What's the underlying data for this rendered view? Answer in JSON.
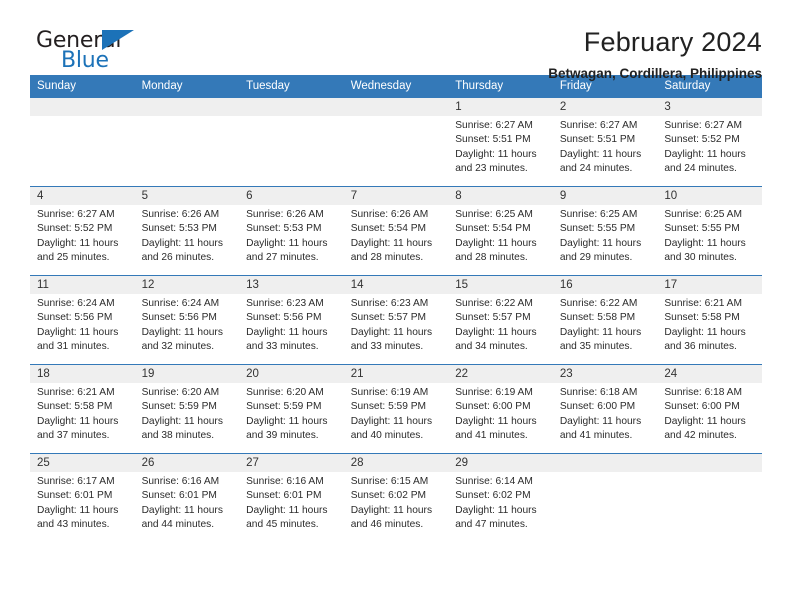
{
  "brand": {
    "name_top": "General",
    "name_bottom": "Blue"
  },
  "header": {
    "title": "February 2024",
    "subtitle": "Betwagan, Cordillera, Philippines"
  },
  "weekday_headers": [
    "Sunday",
    "Monday",
    "Tuesday",
    "Wednesday",
    "Thursday",
    "Friday",
    "Saturday"
  ],
  "labels": {
    "sunrise_prefix": "Sunrise:",
    "sunset_prefix": "Sunset:",
    "daylight_prefix": "Daylight:"
  },
  "colors": {
    "header_blue": "#3479b8",
    "brand_blue": "#1c72b8",
    "daynum_bg": "#efefef"
  },
  "weeks": [
    [
      {
        "empty": true
      },
      {
        "empty": true
      },
      {
        "empty": true
      },
      {
        "empty": true
      },
      {
        "day": "1",
        "sunrise": "Sunrise: 6:27 AM",
        "sunset": "Sunset: 5:51 PM",
        "daylight": "Daylight: 11 hours and 23 minutes."
      },
      {
        "day": "2",
        "sunrise": "Sunrise: 6:27 AM",
        "sunset": "Sunset: 5:51 PM",
        "daylight": "Daylight: 11 hours and 24 minutes."
      },
      {
        "day": "3",
        "sunrise": "Sunrise: 6:27 AM",
        "sunset": "Sunset: 5:52 PM",
        "daylight": "Daylight: 11 hours and 24 minutes."
      }
    ],
    [
      {
        "day": "4",
        "sunrise": "Sunrise: 6:27 AM",
        "sunset": "Sunset: 5:52 PM",
        "daylight": "Daylight: 11 hours and 25 minutes."
      },
      {
        "day": "5",
        "sunrise": "Sunrise: 6:26 AM",
        "sunset": "Sunset: 5:53 PM",
        "daylight": "Daylight: 11 hours and 26 minutes."
      },
      {
        "day": "6",
        "sunrise": "Sunrise: 6:26 AM",
        "sunset": "Sunset: 5:53 PM",
        "daylight": "Daylight: 11 hours and 27 minutes."
      },
      {
        "day": "7",
        "sunrise": "Sunrise: 6:26 AM",
        "sunset": "Sunset: 5:54 PM",
        "daylight": "Daylight: 11 hours and 28 minutes."
      },
      {
        "day": "8",
        "sunrise": "Sunrise: 6:25 AM",
        "sunset": "Sunset: 5:54 PM",
        "daylight": "Daylight: 11 hours and 28 minutes."
      },
      {
        "day": "9",
        "sunrise": "Sunrise: 6:25 AM",
        "sunset": "Sunset: 5:55 PM",
        "daylight": "Daylight: 11 hours and 29 minutes."
      },
      {
        "day": "10",
        "sunrise": "Sunrise: 6:25 AM",
        "sunset": "Sunset: 5:55 PM",
        "daylight": "Daylight: 11 hours and 30 minutes."
      }
    ],
    [
      {
        "day": "11",
        "sunrise": "Sunrise: 6:24 AM",
        "sunset": "Sunset: 5:56 PM",
        "daylight": "Daylight: 11 hours and 31 minutes."
      },
      {
        "day": "12",
        "sunrise": "Sunrise: 6:24 AM",
        "sunset": "Sunset: 5:56 PM",
        "daylight": "Daylight: 11 hours and 32 minutes."
      },
      {
        "day": "13",
        "sunrise": "Sunrise: 6:23 AM",
        "sunset": "Sunset: 5:56 PM",
        "daylight": "Daylight: 11 hours and 33 minutes."
      },
      {
        "day": "14",
        "sunrise": "Sunrise: 6:23 AM",
        "sunset": "Sunset: 5:57 PM",
        "daylight": "Daylight: 11 hours and 33 minutes."
      },
      {
        "day": "15",
        "sunrise": "Sunrise: 6:22 AM",
        "sunset": "Sunset: 5:57 PM",
        "daylight": "Daylight: 11 hours and 34 minutes."
      },
      {
        "day": "16",
        "sunrise": "Sunrise: 6:22 AM",
        "sunset": "Sunset: 5:58 PM",
        "daylight": "Daylight: 11 hours and 35 minutes."
      },
      {
        "day": "17",
        "sunrise": "Sunrise: 6:21 AM",
        "sunset": "Sunset: 5:58 PM",
        "daylight": "Daylight: 11 hours and 36 minutes."
      }
    ],
    [
      {
        "day": "18",
        "sunrise": "Sunrise: 6:21 AM",
        "sunset": "Sunset: 5:58 PM",
        "daylight": "Daylight: 11 hours and 37 minutes."
      },
      {
        "day": "19",
        "sunrise": "Sunrise: 6:20 AM",
        "sunset": "Sunset: 5:59 PM",
        "daylight": "Daylight: 11 hours and 38 minutes."
      },
      {
        "day": "20",
        "sunrise": "Sunrise: 6:20 AM",
        "sunset": "Sunset: 5:59 PM",
        "daylight": "Daylight: 11 hours and 39 minutes."
      },
      {
        "day": "21",
        "sunrise": "Sunrise: 6:19 AM",
        "sunset": "Sunset: 5:59 PM",
        "daylight": "Daylight: 11 hours and 40 minutes."
      },
      {
        "day": "22",
        "sunrise": "Sunrise: 6:19 AM",
        "sunset": "Sunset: 6:00 PM",
        "daylight": "Daylight: 11 hours and 41 minutes."
      },
      {
        "day": "23",
        "sunrise": "Sunrise: 6:18 AM",
        "sunset": "Sunset: 6:00 PM",
        "daylight": "Daylight: 11 hours and 41 minutes."
      },
      {
        "day": "24",
        "sunrise": "Sunrise: 6:18 AM",
        "sunset": "Sunset: 6:00 PM",
        "daylight": "Daylight: 11 hours and 42 minutes."
      }
    ],
    [
      {
        "day": "25",
        "sunrise": "Sunrise: 6:17 AM",
        "sunset": "Sunset: 6:01 PM",
        "daylight": "Daylight: 11 hours and 43 minutes."
      },
      {
        "day": "26",
        "sunrise": "Sunrise: 6:16 AM",
        "sunset": "Sunset: 6:01 PM",
        "daylight": "Daylight: 11 hours and 44 minutes."
      },
      {
        "day": "27",
        "sunrise": "Sunrise: 6:16 AM",
        "sunset": "Sunset: 6:01 PM",
        "daylight": "Daylight: 11 hours and 45 minutes."
      },
      {
        "day": "28",
        "sunrise": "Sunrise: 6:15 AM",
        "sunset": "Sunset: 6:02 PM",
        "daylight": "Daylight: 11 hours and 46 minutes."
      },
      {
        "day": "29",
        "sunrise": "Sunrise: 6:14 AM",
        "sunset": "Sunset: 6:02 PM",
        "daylight": "Daylight: 11 hours and 47 minutes."
      },
      {
        "empty": true
      },
      {
        "empty": true
      }
    ]
  ]
}
